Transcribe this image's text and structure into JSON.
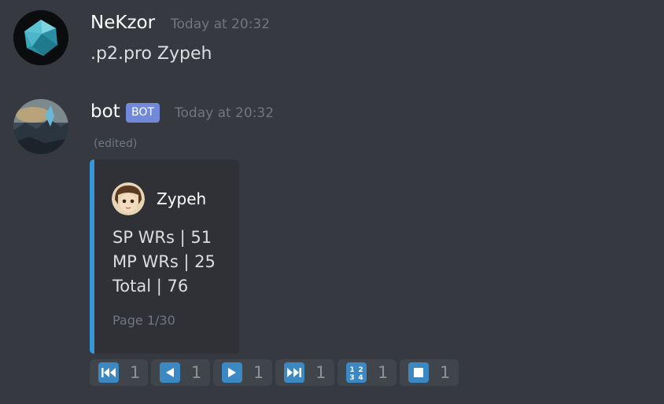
{
  "messages": [
    {
      "username": "NeKzor",
      "timestamp": "Today at 20:32",
      "content": ".p2.pro Zypeh"
    },
    {
      "username": "bot",
      "bot_tag": "BOT",
      "timestamp": "Today at 20:32",
      "edited": "(edited)",
      "embed": {
        "author": "Zypeh",
        "lines": [
          "SP WRs | 51",
          "MP WRs | 25",
          "Total | 76"
        ],
        "footer": "Page 1/30",
        "accent_color": "#3498db"
      }
    }
  ],
  "reactions": [
    {
      "icon": "track-previous-icon",
      "count": "1"
    },
    {
      "icon": "arrow-backward-icon",
      "count": "1"
    },
    {
      "icon": "arrow-forward-icon",
      "count": "1"
    },
    {
      "icon": "track-next-icon",
      "count": "1"
    },
    {
      "icon": "input-numbers-icon",
      "count": "1",
      "glyph": "1234"
    },
    {
      "icon": "stop-button-icon",
      "count": "1"
    }
  ],
  "colors": {
    "background": "#36393f",
    "embed_background": "#2f3136",
    "bot_tag": "#7289da",
    "emoji_blue": "#3b88c3"
  }
}
